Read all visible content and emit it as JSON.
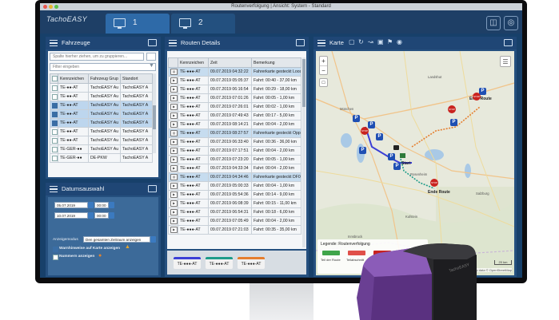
{
  "window": {
    "title": "Routenverfolgung | Ansicht: System - Standard"
  },
  "header": {
    "logo": "TachoEASY",
    "tabs": [
      {
        "label": "1"
      },
      {
        "label": "2"
      }
    ]
  },
  "vehicles_panel": {
    "title": "Fahrzeuge",
    "group_hint": "Spalte hierher ziehen, um zu gruppieren...",
    "filter_placeholder": "Filter eingeben",
    "columns": [
      "Kennzeichen",
      "Fahrzeug Grup",
      "Standort"
    ],
    "rows": [
      {
        "plate": "TE-●●-AT",
        "group": "TachoEASY Au",
        "location": "TachoEASY A",
        "checked": false,
        "selected": false
      },
      {
        "plate": "TE-●●-AT",
        "group": "TachoEASY Au",
        "location": "TachoEASY A",
        "checked": false,
        "selected": false
      },
      {
        "plate": "TE-●●-AT",
        "group": "TachoEASY Au",
        "location": "TachoEASY A",
        "checked": true,
        "selected": true
      },
      {
        "plate": "TE-●●-AT",
        "group": "TachoEASY Au",
        "location": "TachoEASY A",
        "checked": true,
        "selected": true
      },
      {
        "plate": "TE-●●-AT",
        "group": "TachoEASY Au",
        "location": "TachoEASY A",
        "checked": true,
        "selected": true
      },
      {
        "plate": "TE-●●-AT",
        "group": "TachoEASY Au",
        "location": "TachoEASY A",
        "checked": false,
        "selected": false
      },
      {
        "plate": "TE-●●-AT",
        "group": "TachoEASY Au",
        "location": "TachoEASY A",
        "checked": false,
        "selected": false
      },
      {
        "plate": "TE-GER-●●",
        "group": "TachoEASY Au",
        "location": "TachoEASY A",
        "checked": false,
        "selected": false
      },
      {
        "plate": "TE-GER-●●",
        "group": "DE-PKW",
        "location": "TachoEASY A",
        "checked": false,
        "selected": false
      }
    ]
  },
  "date_panel": {
    "title": "Datumsauswahl",
    "from_date": "05.07.2019",
    "from_time": "00:00",
    "to_date": "10.07.2019",
    "to_time": "00:00",
    "display_label": "Anzeigemodus",
    "display_value": "Den gesamten Zeitraum anzeigen",
    "warn_label": "Warnhinweise auf Karte anzeigen",
    "numbers_label": "Nummern anzeigen"
  },
  "routes_panel": {
    "title": "Routen Details",
    "columns": [
      "",
      "Kennzeichen",
      "Zeit",
      "Bemerkung"
    ],
    "rows": [
      {
        "plate": "TE-●●●-AT",
        "time": "09.07.2019 04:32:22",
        "note": "Fahrerkarte gesteckt Loos,",
        "type": "card",
        "hl": true
      },
      {
        "plate": "TE-●●●-AT",
        "time": "09.07.2019 05:05:37",
        "note": "Fahrt: 00:40 - 37,00 km",
        "type": "play",
        "hl": false
      },
      {
        "plate": "TE-●●●-AT",
        "time": "09.07.2019 06:16:54",
        "note": "Fahrt: 00:29 - 18,00 km",
        "type": "play",
        "hl": false
      },
      {
        "plate": "TE-●●●-AT",
        "time": "09.07.2019 07:01:26",
        "note": "Fahrt: 00:05 - 1,00 km",
        "type": "play",
        "hl": false
      },
      {
        "plate": "TE-●●●-AT",
        "time": "09.07.2019 07:26:01",
        "note": "Fahrt: 00:02 - 1,00 km",
        "type": "play",
        "hl": false
      },
      {
        "plate": "TE-●●●-AT",
        "time": "09.07.2019 07:49:43",
        "note": "Fahrt: 00:17 - 5,00 km",
        "type": "play",
        "hl": false
      },
      {
        "plate": "TE-●●●-AT",
        "time": "09.07.2019 08:14:21",
        "note": "Fahrt: 00:04 - 2,00 km",
        "type": "play",
        "hl": false
      },
      {
        "plate": "TE-●●●-AT",
        "time": "09.07.2019 08:27:57",
        "note": "Fahrerkarte gesteckt Oppe",
        "type": "card",
        "hl": true
      },
      {
        "plate": "TE-●●●-AT",
        "time": "09.07.2019 06:33:40",
        "note": "Fahrt: 00:36 - 36,00 km",
        "type": "play",
        "hl": false
      },
      {
        "plate": "TE-●●●-AT",
        "time": "09.07.2019 07:17:51",
        "note": "Fahrt: 00:04 - 2,00 km",
        "type": "play",
        "hl": false
      },
      {
        "plate": "TE-●●●-AT",
        "time": "09.07.2019 07:23:20",
        "note": "Fahrt: 00:05 - 1,00 km",
        "type": "play",
        "hl": false
      },
      {
        "plate": "TE-●●●-AT",
        "time": "09.07.2019 04:33:34",
        "note": "Fahrt: 00:04 - 2,00 km",
        "type": "play",
        "hl": false
      },
      {
        "plate": "TE-●●●-AT",
        "time": "09.07.2019 04:34:46",
        "note": "Fahrerkarte gesteckt DF00",
        "type": "card",
        "hl": true
      },
      {
        "plate": "TE-●●●-AT",
        "time": "09.07.2019 05:00:33",
        "note": "Fahrt: 00:04 - 1,00 km",
        "type": "play",
        "hl": false
      },
      {
        "plate": "TE-●●●-AT",
        "time": "09.07.2019 05:54:36",
        "note": "Fahrt: 00:14 - 9,00 km",
        "type": "play",
        "hl": false
      },
      {
        "plate": "TE-●●●-AT",
        "time": "09.07.2019 06:08:39",
        "note": "Fahrt: 00:15 - 11,00 km",
        "type": "play",
        "hl": false
      },
      {
        "plate": "TE-●●●-AT",
        "time": "09.07.2019 06:54:31",
        "note": "Fahrt: 00:18 - 6,00 km",
        "type": "play",
        "hl": false
      },
      {
        "plate": "TE-●●●-AT",
        "time": "09.07.2019 07:05:49",
        "note": "Fahrt: 00:04 - 2,00 km",
        "type": "play",
        "hl": false
      },
      {
        "plate": "TE-●●●-AT",
        "time": "09.07.2019 07:21:03",
        "note": "Fahrt: 00:35 - 35,00 km",
        "type": "play",
        "hl": false
      }
    ],
    "vehicle_tags": [
      {
        "label": "TE-●●●-AT",
        "color": "#3b3fd6"
      },
      {
        "label": "TE-●●●-AT",
        "color": "#1f9c8a"
      },
      {
        "label": "TE-●●●-AT",
        "color": "#e57e2e"
      }
    ]
  },
  "map_panel": {
    "title": "Karte",
    "zoom_in": "+",
    "zoom_out": "−",
    "labels": [
      "München",
      "Landshut",
      "Rosenheim",
      "Salzburg",
      "Kufstein",
      "Innsbruck"
    ],
    "end_labels": [
      "Ende Route",
      "Ende Route"
    ],
    "start_label": "Start",
    "legend_title": "Legende: Routenverfolgung",
    "legend": [
      {
        "label": "Teil der Route",
        "color": "#3fa54a"
      },
      {
        "label": "Teilabschnitt",
        "color": "#e0504a"
      },
      {
        "label": "",
        "color": "#c9231f"
      },
      {
        "label": "",
        "color": "#1f4fb3"
      }
    ],
    "scale": "20 km",
    "attribution": "Map data © OpenStreetMap"
  },
  "colors": {
    "header": "#1e3f66",
    "panel": "#25507f",
    "accent": "#3b7ac0",
    "stop": "#c9231f",
    "parking": "#1f4fb3"
  },
  "icons": [
    "monitor-icon",
    "hamburger-icon",
    "expand-icon",
    "play-icon",
    "card-icon",
    "filter-icon",
    "zoom-in-icon",
    "zoom-out-icon",
    "layers-icon",
    "book-icon",
    "globe-icon"
  ]
}
